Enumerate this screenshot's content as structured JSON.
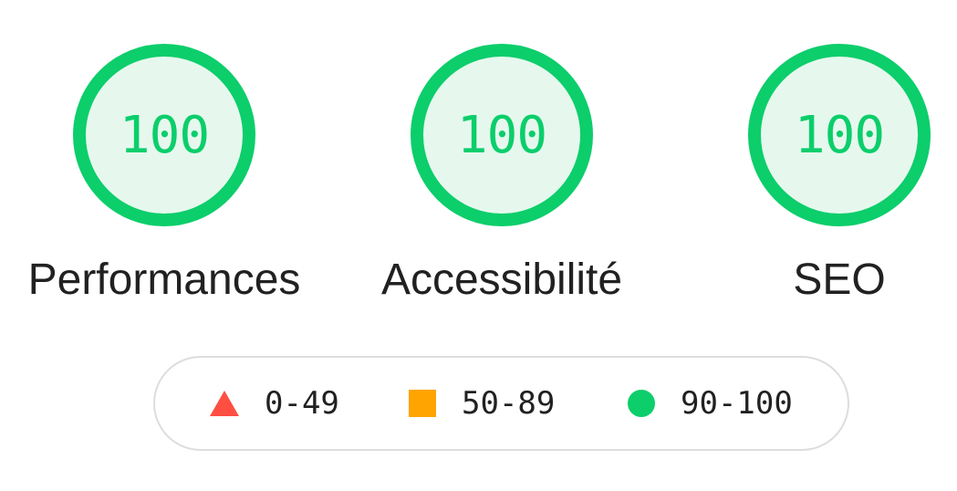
{
  "scores": [
    {
      "value": "100",
      "label": "Performances"
    },
    {
      "value": "100",
      "label": "Accessibilité"
    },
    {
      "value": "100",
      "label": "SEO"
    }
  ],
  "legend": {
    "fail": {
      "range": "0-49",
      "icon": "triangle-icon",
      "color": "#ff4e42"
    },
    "average": {
      "range": "50-89",
      "icon": "square-icon",
      "color": "#ffa400"
    },
    "pass": {
      "range": "90-100",
      "icon": "circle-icon",
      "color": "#0cce6b"
    }
  },
  "colors": {
    "gauge_stroke": "#0cce6b",
    "gauge_fill": "#e6f8ee",
    "text": "#212121",
    "legend_border": "#dddddd"
  }
}
